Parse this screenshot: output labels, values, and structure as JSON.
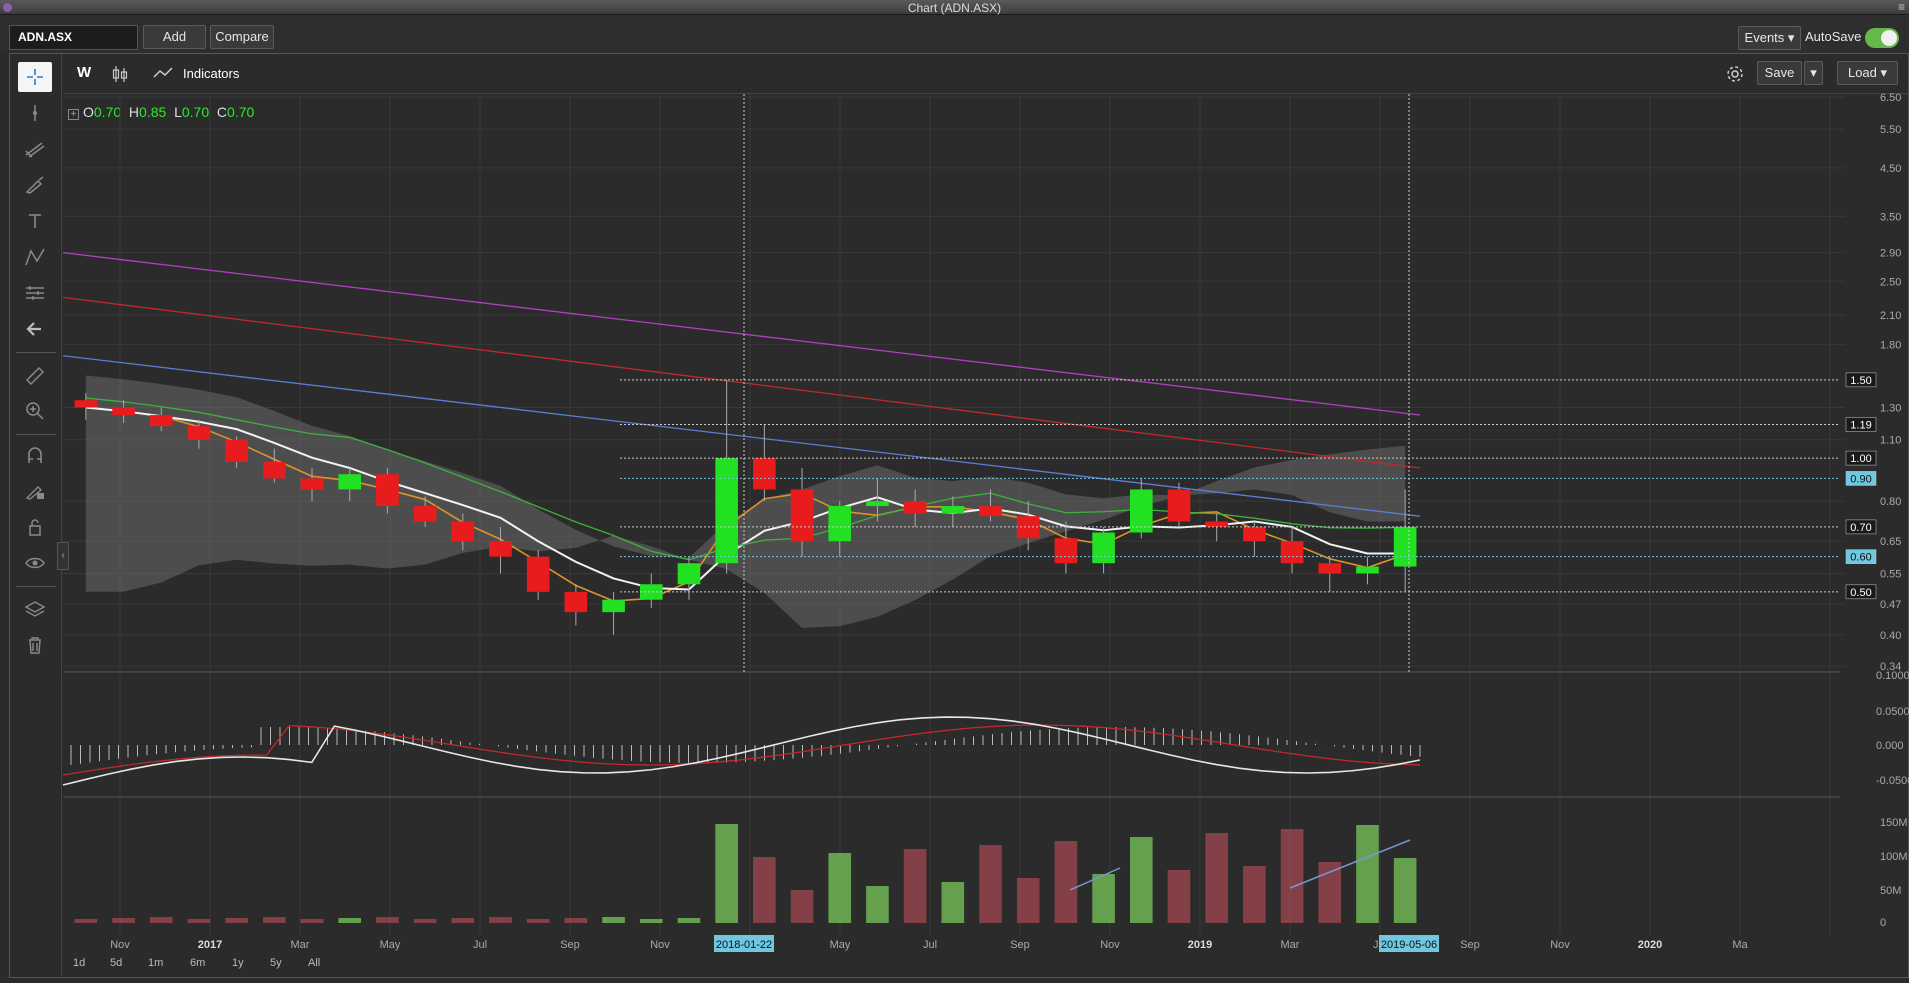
{
  "window": {
    "title": "Chart (ADN.ASX)"
  },
  "topbar": {
    "symbol_value": "ADN.ASX",
    "add_label": "Add",
    "compare_label": "Compare",
    "events_label": "Events",
    "autosave_label": "AutoSave"
  },
  "header": {
    "period": "W",
    "indicators_label": "Indicators",
    "save_label": "Save",
    "load_label": "Load"
  },
  "ohlc": {
    "o_label": "O",
    "o": "0.70",
    "h_label": "H",
    "h": "0.85",
    "l_label": "L",
    "l": "0.70",
    "c_label": "C",
    "c": "0.70"
  },
  "price_axis": [
    "6.50",
    "5.50",
    "4.50",
    "3.50",
    "2.90",
    "2.50",
    "2.10",
    "1.80",
    "1.30",
    "1.10",
    "0.80",
    "0.65",
    "0.55",
    "0.47",
    "0.40",
    "0.34"
  ],
  "price_markers": [
    {
      "label": "1.50",
      "style": "dark"
    },
    {
      "label": "1.19",
      "style": "dark"
    },
    {
      "label": "1.00",
      "style": "dark"
    },
    {
      "label": "0.90",
      "style": "blue"
    },
    {
      "label": "0.70",
      "style": "dark"
    },
    {
      "label": "0.60",
      "style": "blue"
    },
    {
      "label": "0.50",
      "style": "dark"
    }
  ],
  "macd_axis": [
    "0.1000",
    "0.0500",
    "0.000",
    "-0.0500"
  ],
  "volume_axis": [
    "150M",
    "100M",
    "50M",
    "0"
  ],
  "time_axis": [
    "Nov",
    "2017",
    "Mar",
    "May",
    "Jul",
    "Sep",
    "Nov",
    "Mar",
    "May",
    "Jul",
    "Sep",
    "Nov",
    "2019",
    "Mar",
    "Jul",
    "Sep",
    "Nov",
    "2020",
    "Ma"
  ],
  "crosshair_dates": [
    "2018-01-22",
    "2019-05-06"
  ],
  "timeframes": [
    "1d",
    "5d",
    "1m",
    "6m",
    "1y",
    "5y",
    "All"
  ],
  "colors": {
    "up": "#22e022",
    "down": "#e81c1c",
    "accent": "#6fc7e0",
    "toggle": "#66b84a"
  },
  "chart_data": {
    "type": "candlestick",
    "symbol": "ADN.ASX",
    "interval": "W",
    "y_scale": "log",
    "ylim": [
      0.33,
      6.6
    ],
    "series": [
      {
        "values_ohlc_approx": [
          [
            1.35,
            1.4,
            1.22,
            1.3
          ],
          [
            1.3,
            1.35,
            1.2,
            1.25
          ],
          [
            1.25,
            1.3,
            1.15,
            1.18
          ],
          [
            1.18,
            1.22,
            1.05,
            1.1
          ],
          [
            1.1,
            1.12,
            0.95,
            0.98
          ],
          [
            0.98,
            1.05,
            0.88,
            0.9
          ],
          [
            0.9,
            0.95,
            0.8,
            0.85
          ],
          [
            0.85,
            0.95,
            0.8,
            0.92
          ],
          [
            0.92,
            0.95,
            0.75,
            0.78
          ],
          [
            0.78,
            0.82,
            0.7,
            0.72
          ],
          [
            0.72,
            0.75,
            0.62,
            0.65
          ],
          [
            0.65,
            0.7,
            0.55,
            0.6
          ],
          [
            0.6,
            0.62,
            0.48,
            0.5
          ],
          [
            0.5,
            0.52,
            0.42,
            0.45
          ],
          [
            0.45,
            0.5,
            0.4,
            0.48
          ],
          [
            0.48,
            0.55,
            0.46,
            0.52
          ],
          [
            0.52,
            0.6,
            0.48,
            0.58
          ],
          [
            0.58,
            1.5,
            0.55,
            1.0
          ],
          [
            1.0,
            1.19,
            0.8,
            0.85
          ],
          [
            0.85,
            0.95,
            0.6,
            0.65
          ],
          [
            0.65,
            0.8,
            0.6,
            0.78
          ],
          [
            0.78,
            0.9,
            0.72,
            0.8
          ],
          [
            0.8,
            0.85,
            0.7,
            0.75
          ],
          [
            0.75,
            0.82,
            0.7,
            0.78
          ],
          [
            0.78,
            0.85,
            0.72,
            0.74
          ],
          [
            0.74,
            0.8,
            0.62,
            0.66
          ],
          [
            0.66,
            0.72,
            0.55,
            0.58
          ],
          [
            0.58,
            0.7,
            0.55,
            0.68
          ],
          [
            0.68,
            0.9,
            0.66,
            0.85
          ],
          [
            0.85,
            0.88,
            0.7,
            0.72
          ],
          [
            0.72,
            0.75,
            0.65,
            0.7
          ],
          [
            0.7,
            0.72,
            0.6,
            0.65
          ],
          [
            0.65,
            0.7,
            0.55,
            0.58
          ],
          [
            0.58,
            0.6,
            0.5,
            0.55
          ],
          [
            0.55,
            0.6,
            0.52,
            0.57
          ],
          [
            0.57,
            0.85,
            0.5,
            0.7
          ]
        ]
      }
    ],
    "moving_averages": true
  }
}
